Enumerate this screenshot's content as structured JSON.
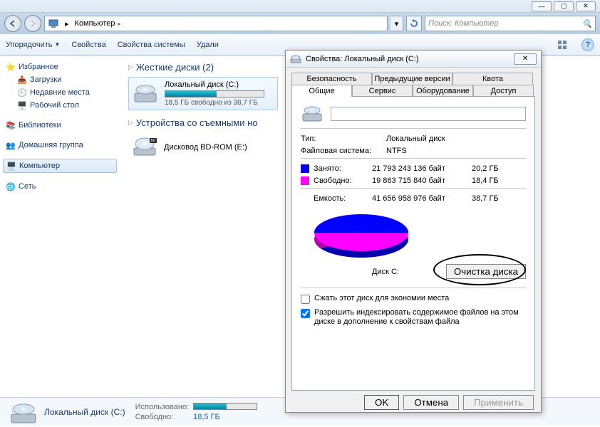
{
  "addr": {
    "location": "Компьютер",
    "search_placeholder": "Поиск: Компьютер"
  },
  "toolbar": {
    "organize": "Упорядочить",
    "properties": "Свойства",
    "sys_properties": "Свойства системы",
    "uninstall": "Удали"
  },
  "sidebar": {
    "favorites": "Избранное",
    "downloads": "Загрузки",
    "recent": "Недавние места",
    "desktop": "Рабочий стол",
    "libraries": "Библиотеки",
    "homegroup": "Домашняя группа",
    "computer": "Компьютер",
    "network": "Сеть"
  },
  "content": {
    "hdd_header": "Жесткие диски (2)",
    "drive_name": "Локальный диск (C:)",
    "drive_free": "18,5 ГБ свободно из 38,7 ГБ",
    "removable_header": "Устройства со съемными но",
    "dvd_name": "Дисковод BD-ROM (E:)"
  },
  "status": {
    "name": "Локальный диск (C:)",
    "used_label": "Использовано:",
    "free_label": "Свободно:",
    "free_value": "18,5 ГБ"
  },
  "dialog": {
    "title": "Свойства: Локальный диск (C:)",
    "tabs": {
      "security": "Безопасность",
      "prev": "Предыдущие версии",
      "quota": "Квота",
      "general": "Общие",
      "service": "Сервис",
      "hardware": "Оборудование",
      "access": "Доступ"
    },
    "type_label": "Тип:",
    "type_value": "Локальный диск",
    "fs_label": "Файловая система:",
    "fs_value": "NTFS",
    "used_label": "Занято:",
    "used_bytes": "21 793 243 136 байт",
    "used_gb": "20,2 ГБ",
    "free_label": "Свободно:",
    "free_bytes": "19 863 715 840 байт",
    "free_gb": "18,4 ГБ",
    "cap_label": "Емкость:",
    "cap_bytes": "41 656 958 976 байт",
    "cap_gb": "38,7 ГБ",
    "disk_label": "Диск C:",
    "cleanup": "Очистка диска",
    "compress": "Сжать этот диск для экономии места",
    "index": "Разрешить индексировать содержимое файлов на этом диске в дополнение к свойствам файла",
    "ok": "OK",
    "cancel": "Отмена",
    "apply": "Применить"
  },
  "chart_data": {
    "type": "pie",
    "title": "",
    "series": [
      {
        "name": "Занято",
        "value": 21793243136,
        "color": "#0000ff"
      },
      {
        "name": "Свободно",
        "value": 19863715840,
        "color": "#ff00ff"
      }
    ]
  },
  "colors": {
    "used": "#0000ff",
    "free": "#ff00ff",
    "teal": "#18b0c0"
  }
}
